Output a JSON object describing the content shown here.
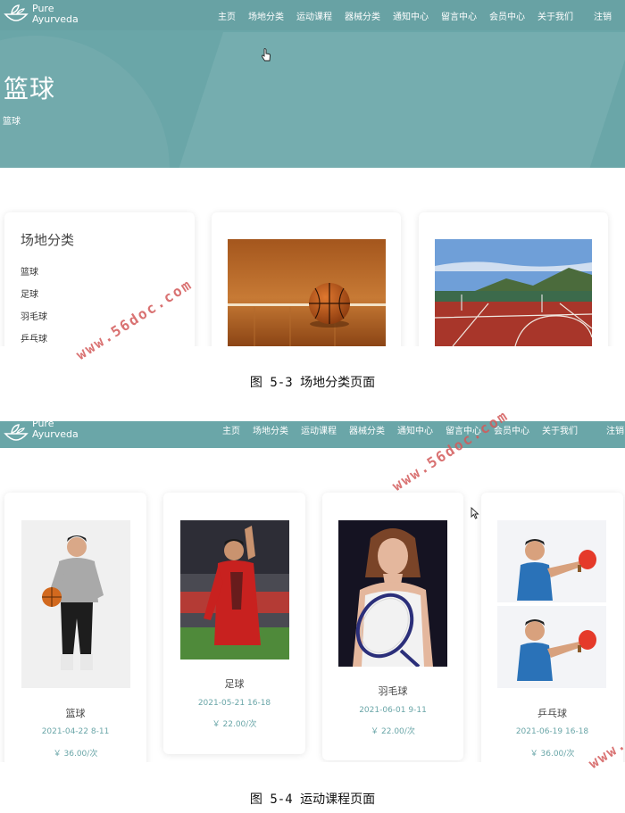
{
  "brand": {
    "line1": "Pure",
    "line2": "Ayurveda"
  },
  "nav": [
    "主页",
    "场地分类",
    "运动课程",
    "器械分类",
    "通知中心",
    "留言中心",
    "会员中心",
    "关于我们"
  ],
  "logout_label": "注销",
  "colors": {
    "teal": "#6aa6a8",
    "watermark": "#d35a5a"
  },
  "figure1": {
    "hero_title": "篮球",
    "breadcrumb": "篮球",
    "sidebar_title": "场地分类",
    "sidebar_items": [
      "篮球",
      "足球",
      "羽毛球",
      "乒乓球"
    ],
    "caption": "图 5-3 场地分类页面"
  },
  "figure2": {
    "courses": [
      {
        "name": "篮球",
        "time": "2021-04-22  8-11",
        "price": "￥ 36.00/次"
      },
      {
        "name": "足球",
        "time": "2021-05-21  16-18",
        "price": "￥ 22.00/次"
      },
      {
        "name": "羽毛球",
        "time": "2021-06-01  9-11",
        "price": "￥ 22.00/次"
      },
      {
        "name": "乒乓球",
        "time": "2021-06-19  16-18",
        "price": "￥ 36.00/次"
      }
    ],
    "caption": "图 5-4 运动课程页面"
  },
  "watermarks": [
    "www.56doc.com",
    "www.56doc.com",
    "www."
  ]
}
